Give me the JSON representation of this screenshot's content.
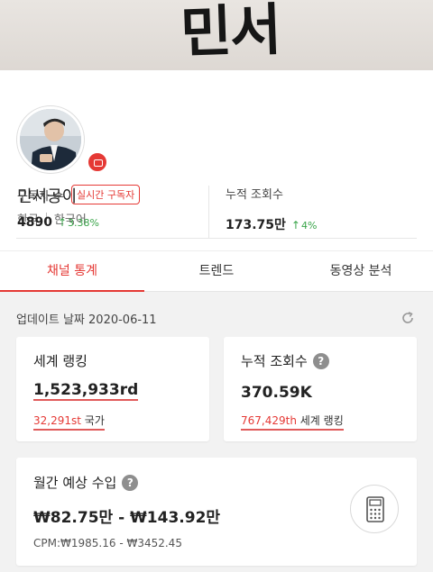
{
  "banner": {
    "text": "민서"
  },
  "channel": {
    "name": "민서공이",
    "country": "한국",
    "language": "한국어",
    "platform_icon": "youtube-icon"
  },
  "stats": {
    "subscribers_label": "구독자 수",
    "realtime_label": "실시간 구독자",
    "subscribers_value": "4890",
    "subscribers_delta": "3.38%",
    "views_label": "누적 조회수",
    "views_value": "173.75만",
    "views_delta": "4%"
  },
  "tabs": [
    {
      "label": "채널 통계",
      "active": true
    },
    {
      "label": "트렌드",
      "active": false
    },
    {
      "label": "동영상 분석",
      "active": false
    }
  ],
  "update": {
    "text": "업데이트 날짜 2020-06-11"
  },
  "ranking_card": {
    "title": "세계 랭킹",
    "value": "1,523,933rd",
    "sub_value": "32,291st",
    "sub_label": "국가"
  },
  "views_card": {
    "title": "누적 조회수",
    "value": "370.59K",
    "sub_value": "767,429th",
    "sub_label": "세계 랭킹"
  },
  "revenue_card": {
    "title": "월간 예상 수입",
    "value": "₩82.75만 - ₩143.92만",
    "cpm": "CPM:₩1985.16 - ₩3452.45"
  },
  "colors": {
    "accent": "#e53935",
    "positive": "#3aa54a"
  }
}
